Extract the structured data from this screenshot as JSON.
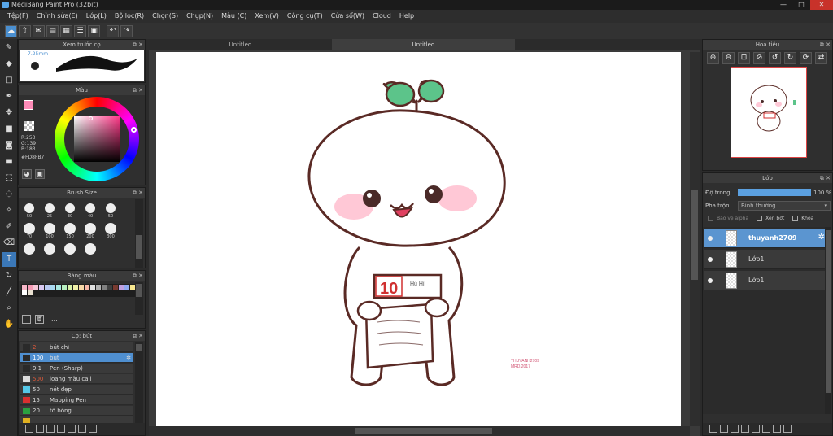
{
  "window": {
    "title": "MediBang Paint Pro (32bit)",
    "min": "—",
    "max": "□",
    "close": "✕"
  },
  "menu": [
    "Tệp(F)",
    "Chỉnh sửa(E)",
    "Lớp(L)",
    "Bộ lọc(R)",
    "Chọn(S)",
    "Chụp(N)",
    "Màu (C)",
    "Xem(V)",
    "Công cụ(T)",
    "Cửa sổ(W)",
    "Cloud",
    "Help"
  ],
  "tabs": [
    "Untitled",
    "Untitled"
  ],
  "brush_preview": {
    "title": "Xem trước cọ",
    "size": "7.25mm"
  },
  "color": {
    "title": "Màu",
    "r": "R:253",
    "g": "G:139",
    "b": "B:183",
    "hex": "#FD8FB7",
    "main": "#fd8bb7",
    "sub": "#8ef0c8"
  },
  "brush_size": {
    "title": "Brush Size",
    "sizes": [
      "50",
      "25",
      "30",
      "40",
      "50",
      "70",
      "100",
      "150",
      "200",
      "300",
      "",
      "",
      "",
      ""
    ]
  },
  "palette": {
    "title": "Bảng màu",
    "extra": "..."
  },
  "brushes": {
    "title": "Cọ: bút",
    "items": [
      {
        "size": "2",
        "name": "bút chì",
        "color": "#2a2a2a",
        "sizecolor": "#e05a3a"
      },
      {
        "size": "100",
        "name": "bút",
        "color": "#2a2a2a",
        "sizecolor": "#ffffff"
      },
      {
        "size": "9.1",
        "name": "Pen (Sharp)",
        "color": "#2a2a2a",
        "sizecolor": "#dddddd"
      },
      {
        "size": "500",
        "name": "loang màu call",
        "color": "#dddddd",
        "sizecolor": "#e05a3a"
      },
      {
        "size": "50",
        "name": "nét đẹp",
        "color": "#55c8e8",
        "sizecolor": "#dddddd"
      },
      {
        "size": "15",
        "name": "Mapping Pen",
        "color": "#d83030",
        "sizecolor": "#dddddd"
      },
      {
        "size": "20",
        "name": "tô bóng",
        "color": "#2aa040",
        "sizecolor": "#dddddd"
      },
      {
        "size": "",
        "name": "",
        "color": "#e0b020",
        "sizecolor": "#dddddd"
      }
    ]
  },
  "navigator": {
    "title": "Hoa tiêu"
  },
  "layers": {
    "title": "Lớp",
    "opacity_label": "Độ trong",
    "opacity": "100 %",
    "blend_label": "Pha trộn",
    "blend": "Bình thường",
    "protect_alpha": "Bảo vệ alpha",
    "clip": "Xén bớt",
    "lock": "Khóa",
    "items": [
      "thuyanh2709",
      "Lớp1",
      "Lớp1"
    ]
  },
  "art": {
    "sign": "10",
    "card": "Hủ Hỉ",
    "watermark1": "THUYANH2709",
    "watermark2": "MRD.2017"
  }
}
